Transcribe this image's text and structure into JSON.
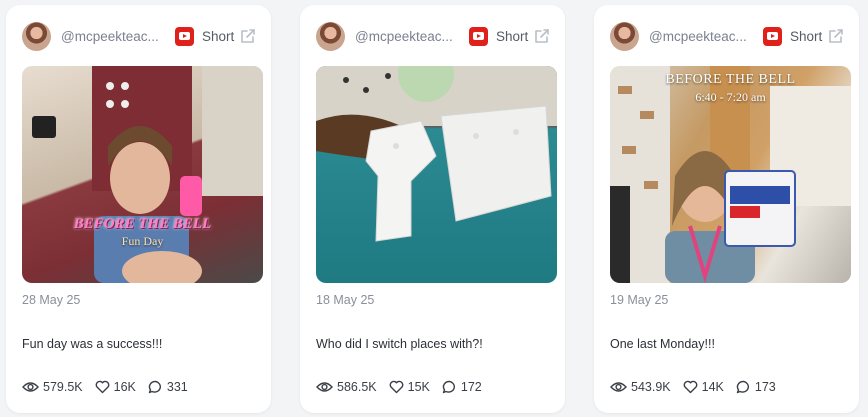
{
  "cards": [
    {
      "handle": "@mcpeekteac...",
      "platform_icon": "youtube-icon",
      "type": "Short",
      "thumbnail_overlay": [
        "BEFORE THE BELL",
        "Fun Day"
      ],
      "date": "28 May 25",
      "caption": "Fun day was a success!!!",
      "views": "579.5K",
      "likes": "16K",
      "comments": "331"
    },
    {
      "handle": "@mcpeekteac...",
      "platform_icon": "youtube-icon",
      "type": "Short",
      "thumbnail_overlay": [],
      "date": "18 May 25",
      "caption": "Who did I switch places with?!",
      "views": "586.5K",
      "likes": "15K",
      "comments": "172"
    },
    {
      "handle": "@mcpeekteac...",
      "platform_icon": "youtube-icon",
      "type": "Short",
      "thumbnail_overlay": [
        "BEFORE THE BELL",
        "6:40 - 7:20 am"
      ],
      "date": "19 May 25",
      "caption": "One last Monday!!!",
      "views": "543.9K",
      "likes": "14K",
      "comments": "173"
    }
  ],
  "colors": {
    "youtube_red": "#e0201b",
    "card_bg": "#ffffff",
    "page_bg": "#f3f4f6"
  },
  "icons": [
    "avatar",
    "youtube-icon",
    "external-link-icon",
    "eye-icon",
    "heart-icon",
    "comment-icon"
  ]
}
